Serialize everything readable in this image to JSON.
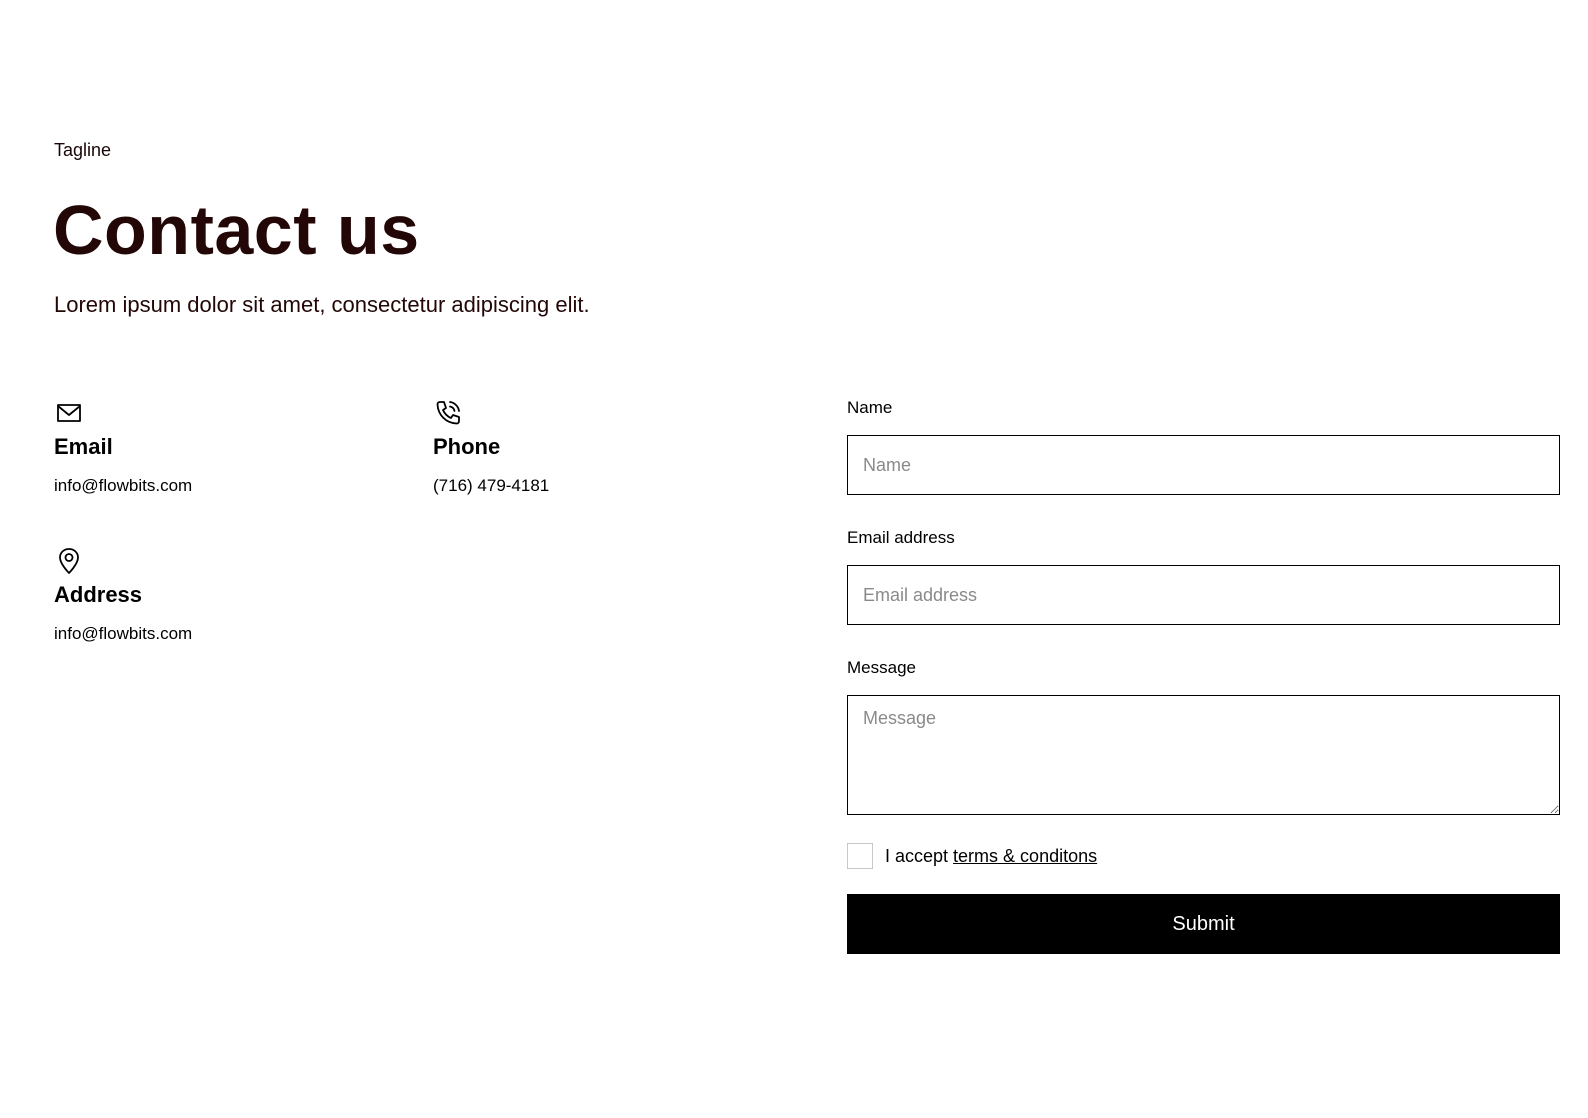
{
  "header": {
    "tagline": "Tagline",
    "title": "Contact us",
    "subtitle": "Lorem ipsum dolor sit amet, consectetur adipiscing elit."
  },
  "contact": {
    "email": {
      "icon": "mail-icon",
      "title": "Email",
      "value": "info@flowbits.com"
    },
    "phone": {
      "icon": "phone-icon",
      "title": "Phone",
      "value": "(716) 479-4181"
    },
    "address": {
      "icon": "map-pin-icon",
      "title": "Address",
      "value": "info@flowbits.com"
    }
  },
  "form": {
    "name": {
      "label": "Name",
      "placeholder": "Name",
      "value": ""
    },
    "email": {
      "label": "Email address",
      "placeholder": "Email address",
      "value": ""
    },
    "message": {
      "label": "Message",
      "placeholder": "Message",
      "value": ""
    },
    "terms": {
      "prefix": "I accept ",
      "link_text": "terms & conditons",
      "checked": false
    },
    "submit_label": "Submit"
  }
}
